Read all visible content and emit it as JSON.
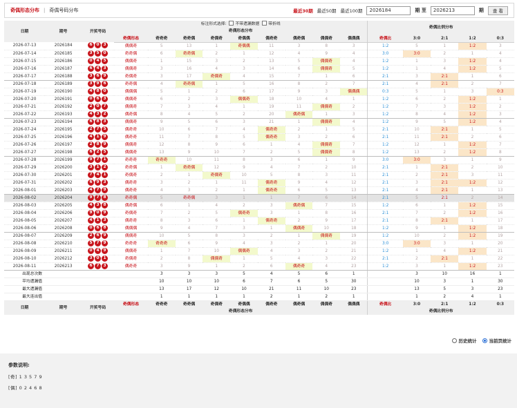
{
  "topbar": {
    "tab_active": "奇偶形态分布",
    "separator": "|",
    "tab_other": "奇偶号码分布",
    "quick": [
      "最近30期",
      "最近50期",
      "最近100期"
    ],
    "from_value": "2026184",
    "from_label": "期 至",
    "to_value": "2026213",
    "to_label": "期",
    "query_label": "查 看"
  },
  "options": {
    "label": "标注形式选择:",
    "items": [
      "不带遗漏数据",
      "带折线"
    ]
  },
  "headers": {
    "date": "日期",
    "issue": "期号",
    "draw": "开奖号码",
    "shape_section": "奇偶形态分布",
    "ratio_section": "奇偶比例分布",
    "shape_cols": [
      "奇偶形态",
      "奇奇奇",
      "奇奇偶",
      "奇偶奇",
      "奇偶偶",
      "偶奇奇",
      "偶奇偶",
      "偶偶奇",
      "偶偶偶"
    ],
    "ratio_cols": [
      "奇偶比",
      "3:0",
      "2:1",
      "1:2",
      "0:3"
    ]
  },
  "rows": [
    {
      "date": "2026-07-13",
      "issue": "2026184",
      "balls": [
        "6",
        "0",
        "3"
      ],
      "pattern": "偶偶奇",
      "shape": [
        "5",
        "13",
        "1",
        "奇偶偶",
        "11",
        "3",
        "8",
        "3"
      ],
      "ratio": "1:2",
      "rcols": [
        "5",
        "1",
        "1:2",
        "3"
      ]
    },
    {
      "date": "2026-07-14",
      "issue": "2026185",
      "balls": [
        "3",
        "5",
        "0"
      ],
      "pattern": "奇奇偶",
      "shape": [
        "6",
        "奇奇偶",
        "2",
        "1",
        "12",
        "4",
        "9",
        "4"
      ],
      "ratio": "3:0",
      "rcols": [
        "3:0",
        "2",
        "1",
        "4"
      ]
    },
    {
      "date": "2026-07-15",
      "issue": "2026186",
      "balls": [
        "0",
        "4",
        "5"
      ],
      "pattern": "偶偶奇",
      "shape": [
        "1",
        "15",
        "3",
        "2",
        "13",
        "5",
        "偶偶奇",
        "4"
      ],
      "ratio": "1:2",
      "rcols": [
        "1",
        "3",
        "1:2",
        "4"
      ]
    },
    {
      "date": "2026-07-16",
      "issue": "2026187",
      "balls": [
        "6",
        "4",
        "3"
      ],
      "pattern": "偶偶奇",
      "shape": [
        "3",
        "16",
        "4",
        "3",
        "14",
        "6",
        "偶偶奇",
        "5"
      ],
      "ratio": "1:2",
      "rcols": [
        "1",
        "4",
        "1:2",
        "5"
      ]
    },
    {
      "date": "2026-07-17",
      "issue": "2026188",
      "balls": [
        "3",
        "6",
        "9"
      ],
      "pattern": "奇偶奇",
      "shape": [
        "3",
        "17",
        "奇偶奇",
        "4",
        "15",
        "7",
        "1",
        "6"
      ],
      "ratio": "2:1",
      "rcols": [
        "3",
        "2:1",
        "1",
        "6"
      ],
      "grp": true
    },
    {
      "date": "2026-07-18",
      "issue": "2026189",
      "balls": [
        "3",
        "9",
        "6"
      ],
      "pattern": "奇奇偶",
      "shape": [
        "4",
        "奇奇偶",
        "1",
        "5",
        "16",
        "8",
        "2",
        "7"
      ],
      "ratio": "2:1",
      "rcols": [
        "4",
        "2:1",
        "2",
        "7"
      ]
    },
    {
      "date": "2026-07-19",
      "issue": "2026190",
      "balls": [
        "4",
        "8",
        "0"
      ],
      "pattern": "偶偶偶",
      "shape": [
        "5",
        "1",
        "2",
        "6",
        "17",
        "9",
        "3",
        "偶偶偶"
      ],
      "ratio": "0:3",
      "rcols": [
        "5",
        "1",
        "3",
        "0:3"
      ]
    },
    {
      "date": "2026-07-20",
      "issue": "2026191",
      "balls": [
        "0",
        "6",
        "3"
      ],
      "pattern": "偶偶奇",
      "shape": [
        "6",
        "2",
        "3",
        "偶偶奇",
        "18",
        "10",
        "4",
        "1"
      ],
      "ratio": "1:2",
      "rcols": [
        "6",
        "2",
        "1:2",
        "1"
      ]
    },
    {
      "date": "2026-07-21",
      "issue": "2026192",
      "balls": [
        "2",
        "0",
        "7"
      ],
      "pattern": "偶偶奇",
      "shape": [
        "7",
        "3",
        "4",
        "1",
        "19",
        "11",
        "偶偶奇",
        "2"
      ],
      "ratio": "1:2",
      "rcols": [
        "7",
        "3",
        "1:2",
        "2"
      ]
    },
    {
      "date": "2026-07-22",
      "issue": "2026193",
      "balls": [
        "4",
        "3",
        "2"
      ],
      "pattern": "偶奇偶",
      "shape": [
        "8",
        "4",
        "5",
        "2",
        "20",
        "偶奇偶",
        "1",
        "3"
      ],
      "ratio": "1:2",
      "rcols": [
        "8",
        "4",
        "1:2",
        "3"
      ],
      "grp": true
    },
    {
      "date": "2026-07-23",
      "issue": "2026194",
      "balls": [
        "6",
        "8",
        "3"
      ],
      "pattern": "偶偶奇",
      "shape": [
        "9",
        "5",
        "6",
        "3",
        "21",
        "1",
        "偶偶奇",
        "4"
      ],
      "ratio": "1:2",
      "rcols": [
        "9",
        "5",
        "1:2",
        "4"
      ]
    },
    {
      "date": "2026-07-24",
      "issue": "2026195",
      "balls": [
        "2",
        "7",
        "5"
      ],
      "pattern": "偶奇奇",
      "shape": [
        "10",
        "6",
        "7",
        "4",
        "偶奇奇",
        "2",
        "1",
        "5"
      ],
      "ratio": "2:1",
      "rcols": [
        "10",
        "2:1",
        "1",
        "5"
      ]
    },
    {
      "date": "2026-07-25",
      "issue": "2026196",
      "balls": [
        "4",
        "1",
        "9"
      ],
      "pattern": "偶奇奇",
      "shape": [
        "11",
        "7",
        "8",
        "5",
        "偶奇奇",
        "3",
        "2",
        "6"
      ],
      "ratio": "2:1",
      "rcols": [
        "11",
        "2:1",
        "2",
        "6"
      ]
    },
    {
      "date": "2026-07-26",
      "issue": "2026197",
      "balls": [
        "2",
        "8",
        "9"
      ],
      "pattern": "偶偶奇",
      "shape": [
        "12",
        "8",
        "9",
        "6",
        "1",
        "4",
        "偶偶奇",
        "7"
      ],
      "ratio": "1:2",
      "rcols": [
        "12",
        "1",
        "1:2",
        "7"
      ]
    },
    {
      "date": "2026-07-27",
      "issue": "2026198",
      "balls": [
        "6",
        "2",
        "5"
      ],
      "pattern": "偶偶奇",
      "shape": [
        "13",
        "9",
        "10",
        "7",
        "2",
        "5",
        "偶偶奇",
        "8"
      ],
      "ratio": "1:2",
      "rcols": [
        "13",
        "2",
        "1:2",
        "8"
      ],
      "grp": true
    },
    {
      "date": "2026-07-28",
      "issue": "2026199",
      "balls": [
        "9",
        "7",
        "1"
      ],
      "pattern": "奇奇奇",
      "shape": [
        "奇奇奇",
        "10",
        "11",
        "8",
        "3",
        "6",
        "1",
        "9"
      ],
      "ratio": "3:0",
      "rcols": [
        "3:0",
        "3",
        "1",
        "9"
      ]
    },
    {
      "date": "2026-07-29",
      "issue": "2026200",
      "balls": [
        "3",
        "1",
        "2"
      ],
      "pattern": "奇奇偶",
      "shape": [
        "1",
        "奇奇偶",
        "12",
        "9",
        "4",
        "7",
        "2",
        "10"
      ],
      "ratio": "2:1",
      "rcols": [
        "1",
        "2:1",
        "2",
        "10"
      ]
    },
    {
      "date": "2026-07-30",
      "issue": "2026201",
      "balls": [
        "7",
        "4",
        "1"
      ],
      "pattern": "奇偶奇",
      "shape": [
        "2",
        "1",
        "奇偶奇",
        "10",
        "5",
        "8",
        "3",
        "11"
      ],
      "ratio": "2:1",
      "rcols": [
        "2",
        "2:1",
        "3",
        "11"
      ]
    },
    {
      "date": "2026-07-31",
      "issue": "2026202",
      "balls": [
        "6",
        "9",
        "3"
      ],
      "pattern": "偶奇奇",
      "shape": [
        "3",
        "2",
        "1",
        "11",
        "偶奇奇",
        "9",
        "4",
        "12"
      ],
      "ratio": "2:1",
      "rcols": [
        "3",
        "2:1",
        "1:2",
        "12"
      ]
    },
    {
      "date": "2026-08-01",
      "issue": "2026203",
      "balls": [
        "4",
        "7",
        "9"
      ],
      "pattern": "偶奇奇",
      "shape": [
        "4",
        "3",
        "2",
        "1",
        "偶奇奇",
        "6",
        "5",
        "13"
      ],
      "ratio": "2:1",
      "rcols": [
        "4",
        "2:1",
        "1",
        "13"
      ],
      "grp": true
    },
    {
      "date": "2026-08-02",
      "issue": "2026204",
      "balls": [
        "9",
        "7",
        "8"
      ],
      "pattern": "奇奇偶",
      "shape": [
        "5",
        "奇奇偶",
        "3",
        "1",
        "1",
        "7",
        "6",
        "14"
      ],
      "ratio": "2:1",
      "rcols": [
        "5",
        "2:1",
        "2",
        "14"
      ],
      "hl": true
    },
    {
      "date": "2026-08-03",
      "issue": "2026205",
      "balls": [
        "4",
        "3",
        "8"
      ],
      "pattern": "偶奇偶",
      "shape": [
        "6",
        "1",
        "4",
        "2",
        "3",
        "偶奇偶",
        "7",
        "15"
      ],
      "ratio": "1:2",
      "rcols": [
        "6",
        "1",
        "1:2",
        "15"
      ]
    },
    {
      "date": "2026-08-04",
      "issue": "2026206",
      "balls": [
        "9",
        "0",
        "9"
      ],
      "pattern": "奇偶奇",
      "shape": [
        "7",
        "2",
        "5",
        "偶奇奇",
        "3",
        "1",
        "8",
        "16"
      ],
      "ratio": "2:1",
      "rcols": [
        "7",
        "2",
        "1:2",
        "16"
      ]
    },
    {
      "date": "2026-08-05",
      "issue": "2026207",
      "balls": [
        "4",
        "1",
        "3"
      ],
      "pattern": "偶奇奇",
      "shape": [
        "8",
        "3",
        "6",
        "1",
        "偶奇奇",
        "2",
        "9",
        "17"
      ],
      "ratio": "2:1",
      "rcols": [
        "8",
        "2:1",
        "1",
        "17"
      ]
    },
    {
      "date": "2026-08-06",
      "issue": "2026208",
      "balls": [
        "0",
        "6",
        "8"
      ],
      "pattern": "偶偶偶",
      "shape": [
        "9",
        "4",
        "7",
        "3",
        "1",
        "偶偶奇",
        "10",
        "18"
      ],
      "ratio": "1:2",
      "rcols": [
        "9",
        "1",
        "1:2",
        "18"
      ],
      "grp": true
    },
    {
      "date": "2026-08-07",
      "issue": "2026209",
      "balls": [
        "2",
        "6",
        "9"
      ],
      "pattern": "偶偶奇",
      "shape": [
        "10",
        "5",
        "8",
        "3",
        "2",
        "1",
        "偶偶奇",
        "19"
      ],
      "ratio": "1:2",
      "rcols": [
        "10",
        "2",
        "1:2",
        "19"
      ]
    },
    {
      "date": "2026-08-08",
      "issue": "2026210",
      "balls": [
        "5",
        "7",
        "9"
      ],
      "pattern": "奇奇奇",
      "shape": [
        "奇奇奇",
        "6",
        "9",
        "4",
        "3",
        "2",
        "1",
        "20"
      ],
      "ratio": "3:0",
      "rcols": [
        "3:0",
        "3",
        "1",
        "20"
      ]
    },
    {
      "date": "2026-08-09",
      "issue": "2026211",
      "balls": [
        "0",
        "4",
        "9"
      ],
      "pattern": "偶偶奇",
      "shape": [
        "1",
        "7",
        "10",
        "偶偶奇",
        "4",
        "3",
        "2",
        "21"
      ],
      "ratio": "1:2",
      "rcols": [
        "1",
        "4",
        "1:2",
        "21"
      ]
    },
    {
      "date": "2026-08-10",
      "issue": "2026212",
      "balls": [
        "3",
        "0",
        "1"
      ],
      "pattern": "奇偶奇",
      "shape": [
        "2",
        "8",
        "偶偶奇",
        "1",
        "5",
        "4",
        "3",
        "22"
      ],
      "ratio": "2:1",
      "rcols": [
        "2",
        "2:1",
        "1",
        "22"
      ]
    },
    {
      "date": "2026-08-11",
      "issue": "2026213",
      "balls": [
        "6",
        "7",
        "3"
      ],
      "pattern": "偶奇奇",
      "shape": [
        "3",
        "9",
        "1",
        "2",
        "6",
        "偶奇奇",
        "4",
        "23"
      ],
      "ratio": "1:2",
      "rcols": [
        "3",
        "1",
        "1:2",
        "23"
      ],
      "grp": true
    }
  ],
  "stats": [
    {
      "label": "出现总次数",
      "shape": [
        "3",
        "3",
        "3",
        "5",
        "4",
        "5",
        "6",
        "1"
      ],
      "ratio": [
        "3",
        "10",
        "16",
        "1"
      ]
    },
    {
      "label": "平均遗漏值",
      "shape": [
        "10",
        "10",
        "10",
        "6",
        "7",
        "6",
        "5",
        "30"
      ],
      "ratio": [
        "10",
        "3",
        "1",
        "30"
      ]
    },
    {
      "label": "最大遗漏值",
      "shape": [
        "13",
        "17",
        "12",
        "10",
        "21",
        "11",
        "10",
        "23"
      ],
      "ratio": [
        "13",
        "5",
        "3",
        "23"
      ]
    },
    {
      "label": "最大连出值",
      "shape": [
        "1",
        "1",
        "1",
        "1",
        "2",
        "1",
        "2",
        "1"
      ],
      "ratio": [
        "1",
        "2",
        "4",
        "1"
      ]
    }
  ],
  "stat_switch": [
    "历史统计",
    "当前页统计"
  ],
  "legend": {
    "title": "参数说明:",
    "odd": "[奇] 1 3 5 7 9",
    "even": "[偶] 0 2 4 6 8"
  },
  "colors": {
    "accent": "#c8161d",
    "ratio_blue": "#2b8fd6",
    "shape_hit_bg": "#f3f9cc",
    "ratio_hit_bg": "#fbe6c8"
  }
}
